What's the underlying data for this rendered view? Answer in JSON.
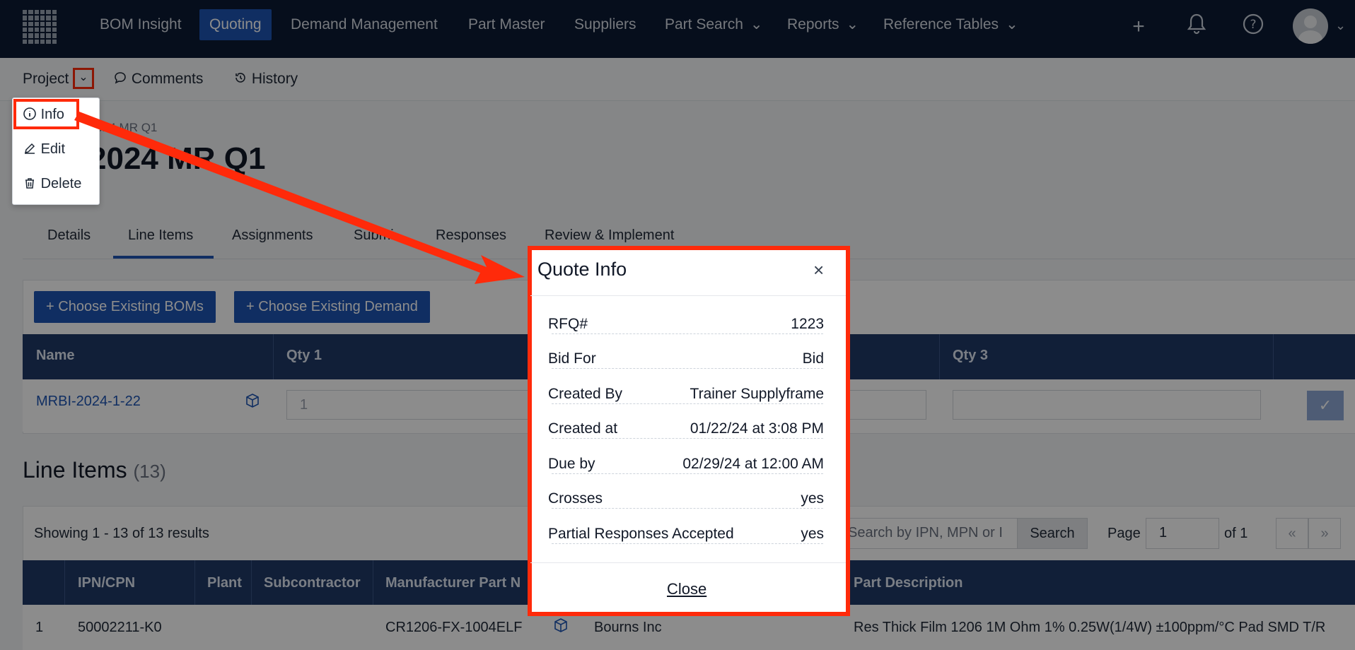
{
  "nav": {
    "items": [
      "BOM Insight",
      "Quoting",
      "Demand Management",
      "Part Master",
      "Suppliers",
      "Part Search",
      "Reports",
      "Reference Tables"
    ]
  },
  "subbar": {
    "project": "Project",
    "comments": "Comments",
    "history": "History"
  },
  "project_menu": {
    "info": "Info",
    "edit": "Edit",
    "delete": "Delete"
  },
  "page": {
    "breadcrumb": "2024 MR Q1",
    "title": "2024 MR Q1"
  },
  "tabs": [
    "Details",
    "Line Items",
    "Assignments",
    "Submi",
    "Responses",
    "Review & Implement"
  ],
  "buttons": {
    "choose_boms": "Choose Existing BOMs",
    "choose_demand": "Choose Existing Demand"
  },
  "bom_table": {
    "headers": {
      "name": "Name",
      "qty1": "Qty 1",
      "qty3": "Qty 3"
    },
    "row": {
      "name": "MRBI-2024-1-22",
      "qty1": "1"
    }
  },
  "line_items": {
    "heading": "Line Items",
    "count": "(13)",
    "showing": "Showing 1 - 13 of 13 results",
    "search_placeholder": "Search by IPN, MPN or I",
    "search_button": "Search",
    "page_label": "Page",
    "page_value": "1",
    "of_label": "of 1",
    "prev": "«",
    "next": "»",
    "headers": {
      "ipn": "IPN/CPN",
      "plant": "Plant",
      "sub": "Subcontractor",
      "mpn": "Manufacturer Part N",
      "desc": "Part Description"
    },
    "row": {
      "num": "1",
      "ipn": "50002211-K0",
      "mpn": "CR1206-FX-1004ELF",
      "mfr": "Bourns Inc",
      "desc": "Res Thick Film 1206 1M Ohm 1% 0.25W(1/4W) ±100ppm/°C Pad SMD T/R"
    }
  },
  "modal": {
    "title": "Quote Info",
    "close_x": "×",
    "rows": [
      {
        "label": "RFQ#",
        "value": "1223"
      },
      {
        "label": "Bid For",
        "value": "Bid"
      },
      {
        "label": "Created By",
        "value": "Trainer Supplyframe"
      },
      {
        "label": "Created at",
        "value": "01/22/24 at 3:08 PM"
      },
      {
        "label": "Due by",
        "value": "02/29/24 at 12:00 AM"
      },
      {
        "label": "Crosses",
        "value": "yes"
      },
      {
        "label": "Partial Responses Accepted",
        "value": "yes"
      }
    ],
    "close_label": "Close"
  },
  "colors": {
    "nav_bg": "#0c1a33",
    "accent": "#1e55b3",
    "highlight": "#ff2a0a",
    "table_header": "#1f3a66"
  },
  "icons": [
    "grid-logo-icon",
    "plus-icon",
    "bell-icon",
    "help-icon",
    "avatar-icon",
    "chevron-down-icon",
    "comment-icon",
    "history-icon",
    "info-icon",
    "pencil-icon",
    "trash-icon",
    "cube-icon",
    "check-icon",
    "close-icon"
  ]
}
